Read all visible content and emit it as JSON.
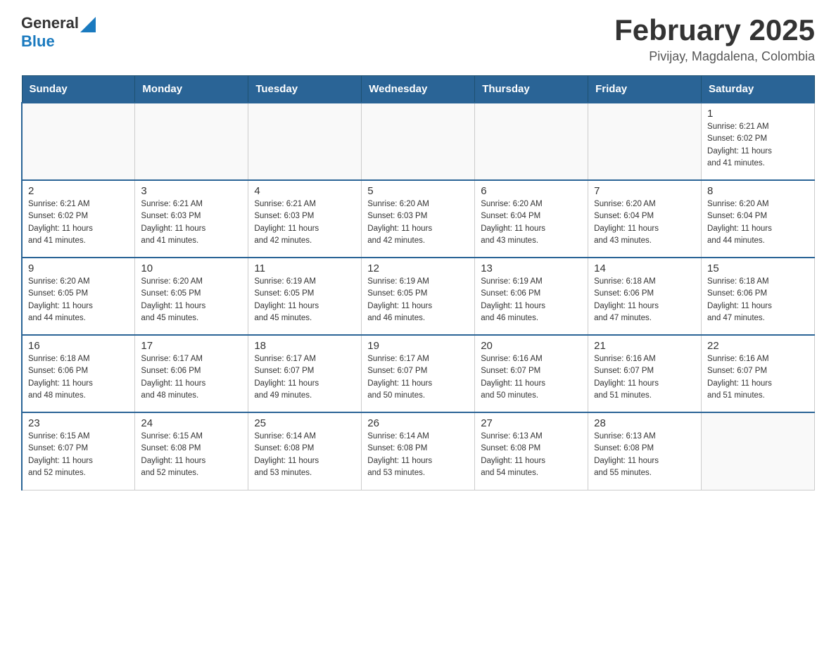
{
  "header": {
    "logo_general": "General",
    "logo_blue": "Blue",
    "title": "February 2025",
    "location": "Pivijay, Magdalena, Colombia"
  },
  "days_of_week": [
    "Sunday",
    "Monday",
    "Tuesday",
    "Wednesday",
    "Thursday",
    "Friday",
    "Saturday"
  ],
  "weeks": [
    [
      {
        "day": "",
        "info": ""
      },
      {
        "day": "",
        "info": ""
      },
      {
        "day": "",
        "info": ""
      },
      {
        "day": "",
        "info": ""
      },
      {
        "day": "",
        "info": ""
      },
      {
        "day": "",
        "info": ""
      },
      {
        "day": "1",
        "info": "Sunrise: 6:21 AM\nSunset: 6:02 PM\nDaylight: 11 hours\nand 41 minutes."
      }
    ],
    [
      {
        "day": "2",
        "info": "Sunrise: 6:21 AM\nSunset: 6:02 PM\nDaylight: 11 hours\nand 41 minutes."
      },
      {
        "day": "3",
        "info": "Sunrise: 6:21 AM\nSunset: 6:03 PM\nDaylight: 11 hours\nand 41 minutes."
      },
      {
        "day": "4",
        "info": "Sunrise: 6:21 AM\nSunset: 6:03 PM\nDaylight: 11 hours\nand 42 minutes."
      },
      {
        "day": "5",
        "info": "Sunrise: 6:20 AM\nSunset: 6:03 PM\nDaylight: 11 hours\nand 42 minutes."
      },
      {
        "day": "6",
        "info": "Sunrise: 6:20 AM\nSunset: 6:04 PM\nDaylight: 11 hours\nand 43 minutes."
      },
      {
        "day": "7",
        "info": "Sunrise: 6:20 AM\nSunset: 6:04 PM\nDaylight: 11 hours\nand 43 minutes."
      },
      {
        "day": "8",
        "info": "Sunrise: 6:20 AM\nSunset: 6:04 PM\nDaylight: 11 hours\nand 44 minutes."
      }
    ],
    [
      {
        "day": "9",
        "info": "Sunrise: 6:20 AM\nSunset: 6:05 PM\nDaylight: 11 hours\nand 44 minutes."
      },
      {
        "day": "10",
        "info": "Sunrise: 6:20 AM\nSunset: 6:05 PM\nDaylight: 11 hours\nand 45 minutes."
      },
      {
        "day": "11",
        "info": "Sunrise: 6:19 AM\nSunset: 6:05 PM\nDaylight: 11 hours\nand 45 minutes."
      },
      {
        "day": "12",
        "info": "Sunrise: 6:19 AM\nSunset: 6:05 PM\nDaylight: 11 hours\nand 46 minutes."
      },
      {
        "day": "13",
        "info": "Sunrise: 6:19 AM\nSunset: 6:06 PM\nDaylight: 11 hours\nand 46 minutes."
      },
      {
        "day": "14",
        "info": "Sunrise: 6:18 AM\nSunset: 6:06 PM\nDaylight: 11 hours\nand 47 minutes."
      },
      {
        "day": "15",
        "info": "Sunrise: 6:18 AM\nSunset: 6:06 PM\nDaylight: 11 hours\nand 47 minutes."
      }
    ],
    [
      {
        "day": "16",
        "info": "Sunrise: 6:18 AM\nSunset: 6:06 PM\nDaylight: 11 hours\nand 48 minutes."
      },
      {
        "day": "17",
        "info": "Sunrise: 6:17 AM\nSunset: 6:06 PM\nDaylight: 11 hours\nand 48 minutes."
      },
      {
        "day": "18",
        "info": "Sunrise: 6:17 AM\nSunset: 6:07 PM\nDaylight: 11 hours\nand 49 minutes."
      },
      {
        "day": "19",
        "info": "Sunrise: 6:17 AM\nSunset: 6:07 PM\nDaylight: 11 hours\nand 50 minutes."
      },
      {
        "day": "20",
        "info": "Sunrise: 6:16 AM\nSunset: 6:07 PM\nDaylight: 11 hours\nand 50 minutes."
      },
      {
        "day": "21",
        "info": "Sunrise: 6:16 AM\nSunset: 6:07 PM\nDaylight: 11 hours\nand 51 minutes."
      },
      {
        "day": "22",
        "info": "Sunrise: 6:16 AM\nSunset: 6:07 PM\nDaylight: 11 hours\nand 51 minutes."
      }
    ],
    [
      {
        "day": "23",
        "info": "Sunrise: 6:15 AM\nSunset: 6:07 PM\nDaylight: 11 hours\nand 52 minutes."
      },
      {
        "day": "24",
        "info": "Sunrise: 6:15 AM\nSunset: 6:08 PM\nDaylight: 11 hours\nand 52 minutes."
      },
      {
        "day": "25",
        "info": "Sunrise: 6:14 AM\nSunset: 6:08 PM\nDaylight: 11 hours\nand 53 minutes."
      },
      {
        "day": "26",
        "info": "Sunrise: 6:14 AM\nSunset: 6:08 PM\nDaylight: 11 hours\nand 53 minutes."
      },
      {
        "day": "27",
        "info": "Sunrise: 6:13 AM\nSunset: 6:08 PM\nDaylight: 11 hours\nand 54 minutes."
      },
      {
        "day": "28",
        "info": "Sunrise: 6:13 AM\nSunset: 6:08 PM\nDaylight: 11 hours\nand 55 minutes."
      },
      {
        "day": "",
        "info": ""
      }
    ]
  ]
}
